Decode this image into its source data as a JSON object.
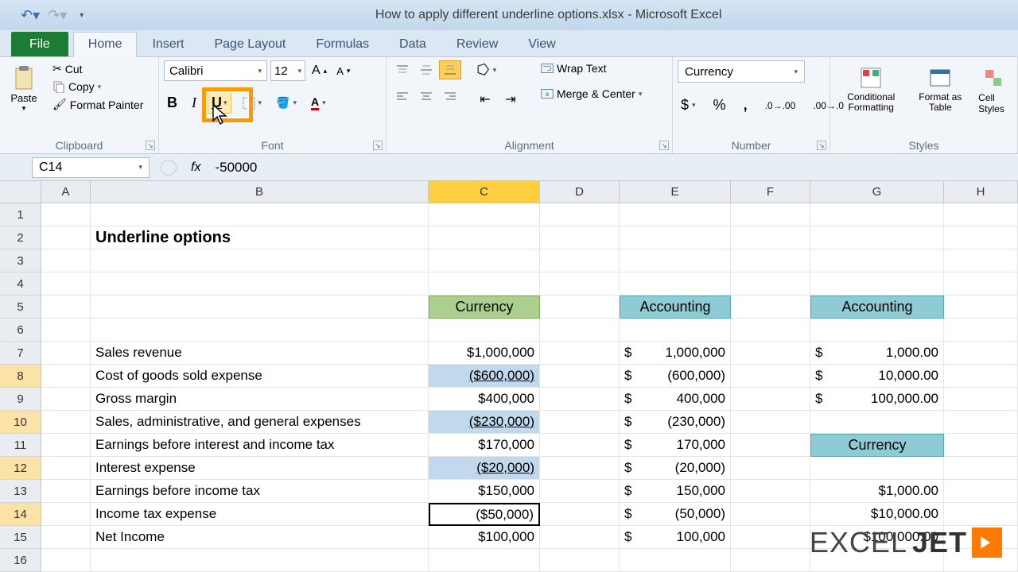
{
  "title": "How to apply different underline options.xlsx - Microsoft Excel",
  "tabs": {
    "file": "File",
    "home": "Home",
    "insert": "Insert",
    "pagelayout": "Page Layout",
    "formulas": "Formulas",
    "data": "Data",
    "review": "Review",
    "view": "View"
  },
  "clipboard": {
    "paste": "Paste",
    "cut": "Cut",
    "copy": "Copy",
    "painter": "Format Painter",
    "label": "Clipboard"
  },
  "font": {
    "name": "Calibri",
    "size": "12",
    "label": "Font"
  },
  "alignment": {
    "wrap": "Wrap Text",
    "merge": "Merge & Center",
    "label": "Alignment"
  },
  "number": {
    "format": "Currency",
    "label": "Number"
  },
  "styles": {
    "cond": "Conditional Formatting",
    "table": "Format as Table",
    "cell": "Cell Styles",
    "label": "Styles"
  },
  "namebox": "C14",
  "formula": "-50000",
  "colHeaders": [
    "A",
    "B",
    "C",
    "D",
    "E",
    "F",
    "G",
    "H"
  ],
  "rowData": {
    "title": "Underline options",
    "hdrC": "Currency",
    "hdrE": "Accounting",
    "hdrG": "Accounting",
    "hdrG11": "Currency",
    "labels": [
      "Sales revenue",
      "Cost of goods sold expense",
      "Gross margin",
      "Sales, administrative, and general expenses",
      "Earnings before interest and income tax",
      "Interest expense",
      "Earnings before income tax",
      "Income tax expense",
      "Net Income"
    ],
    "colC": [
      "$1,000,000",
      "($600,000)",
      "$400,000",
      "($230,000)",
      "$170,000",
      "($20,000)",
      "$150,000",
      "($50,000)",
      "$100,000"
    ],
    "colE": [
      "1,000,000",
      "(600,000)",
      "400,000",
      "(230,000)",
      "170,000",
      "(20,000)",
      "150,000",
      "(50,000)",
      "100,000"
    ],
    "colG": [
      "1,000.00",
      "10,000.00",
      "100,000.00"
    ],
    "colG2": [
      "$1,000.00",
      "$10,000.00",
      "$100,000.00"
    ],
    "dollar": "$"
  },
  "logo": {
    "a": "EXCEL",
    "b": "JET"
  }
}
